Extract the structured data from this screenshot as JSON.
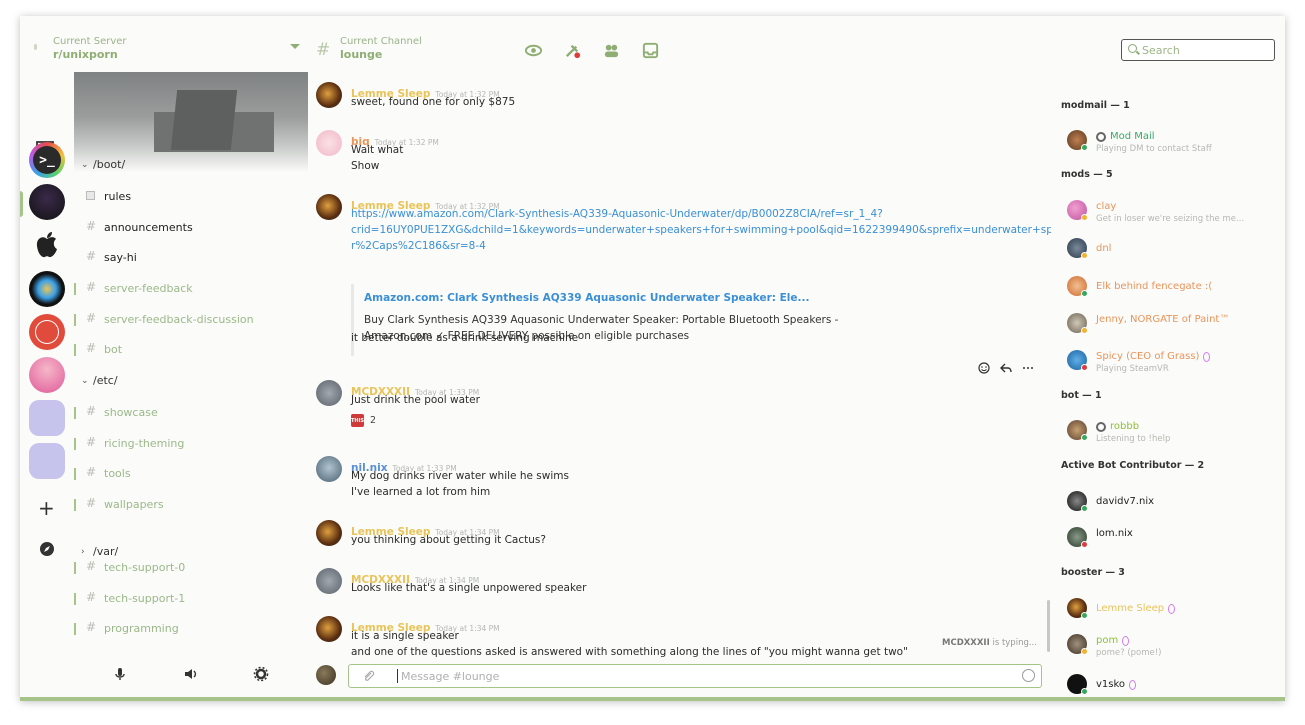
{
  "header": {
    "server_label": "Current Server",
    "server_name": "r/unixporn",
    "channel_label": "Current Channel",
    "channel_name": "lounge",
    "search_placeholder": "Search"
  },
  "channels": {
    "categories": [
      "/boot/",
      "/etc/",
      "/var/"
    ],
    "items": [
      {
        "name": "rules",
        "state": "read"
      },
      {
        "name": "announcements",
        "state": "read"
      },
      {
        "name": "say-hi",
        "state": "read"
      },
      {
        "name": "server-feedback",
        "state": "unread"
      },
      {
        "name": "server-feedback-discussion",
        "state": "unread"
      },
      {
        "name": "bot",
        "state": "unread"
      },
      {
        "name": "showcase",
        "state": "unread"
      },
      {
        "name": "ricing-theming",
        "state": "unread"
      },
      {
        "name": "tools",
        "state": "unread"
      },
      {
        "name": "wallpapers",
        "state": "unread"
      },
      {
        "name": "tech-support-0",
        "state": "unread"
      },
      {
        "name": "tech-support-1",
        "state": "unread"
      },
      {
        "name": "programming",
        "state": "unread"
      }
    ]
  },
  "messages": [
    {
      "author": "Lemme Sleep",
      "color": "#e8c45a",
      "time": "Today at 1:32 PM",
      "lines": [
        "sweet, found one for only $875"
      ]
    },
    {
      "author": "biq",
      "color": "#e8955a",
      "time": "Today at 1:32 PM",
      "lines": [
        "Wait what",
        "Show"
      ]
    },
    {
      "author": "Lemme Sleep",
      "color": "#e8c45a",
      "time": "Today at 1:32 PM",
      "link_lines": [
        "https://www.amazon.com/Clark-Synthesis-AQ339-Aquasonic-Underwater/dp/B0002Z8CIA/ref=sr_1_4?",
        "crid=16UY0PUE1ZXG&dchild=1&keywords=underwater+speakers+for+swimming+pool&qid=1622399490&sprefix=underwater+speake",
        "r%2Caps%2C186&sr=8-4"
      ],
      "embed": {
        "title": "Amazon.com: Clark Synthesis AQ339 Aquasonic Underwater Speaker: Ele...",
        "desc1": "Buy Clark Synthesis AQ339 Aquasonic Underwater Speaker: Portable Bluetooth Speakers -",
        "desc2": "Amazon.com ✓ FREE DELIVERY possible on eligible purchases"
      },
      "after": "it better double as a drink serving machine"
    },
    {
      "author": "MCDXXXII",
      "color": "#e8c45a",
      "time": "Today at 1:33 PM",
      "lines": [
        "Just drink the pool water"
      ],
      "reaction": {
        "emoji": "THIS",
        "count": "2"
      }
    },
    {
      "author": "nil.nix",
      "color": "#5a8fd6",
      "time": "Today at 1:33 PM",
      "lines": [
        "My dog drinks river water while he swims",
        "I've learned a lot from him"
      ]
    },
    {
      "author": "Lemme Sleep",
      "color": "#e8c45a",
      "time": "Today at 1:34 PM",
      "lines": [
        "you thinking about getting it Cactus?"
      ]
    },
    {
      "author": "MCDXXXII",
      "color": "#e8c45a",
      "time": "Today at 1:34 PM",
      "lines": [
        "Looks like that's a single unpowered speaker"
      ]
    },
    {
      "author": "Lemme Sleep",
      "color": "#e8c45a",
      "time": "Today at 1:34 PM",
      "lines": [
        "it is a single speaker",
        "and one of the questions asked is answered with something along the lines of \"you might wanna get two\""
      ]
    }
  ],
  "typing": {
    "user": "MCDXXXII",
    "text": "is typing..."
  },
  "composer": {
    "placeholder": "Message #lounge"
  },
  "members": {
    "groups": [
      {
        "title": "modmail — 1",
        "members": [
          {
            "name": "Mod Mail",
            "status": "Playing DM to contact Staff",
            "color": "#3aa86a",
            "dot": "#3aa55c"
          }
        ]
      },
      {
        "title": "mods — 5",
        "members": [
          {
            "name": "clay",
            "status": "Get in loser we're seizing the me...",
            "color": "#e8955a",
            "dot": "#f0b232"
          },
          {
            "name": "dnl",
            "status": "",
            "color": "#e8955a",
            "dot": "#f0b232"
          },
          {
            "name": "Elk behind fencegate :(",
            "status": "",
            "color": "#e8955a",
            "dot": "#3aa55c"
          },
          {
            "name": "Jenny, NORGATE of Paint™",
            "status": "",
            "color": "#e8955a",
            "dot": "#f0b232"
          },
          {
            "name": "Spicy (CEO of Grass)",
            "status": "Playing SteamVR",
            "color": "#e8955a",
            "dot": "#d83c3e"
          }
        ]
      },
      {
        "title": "bot — 1",
        "members": [
          {
            "name": "robbb",
            "status": "Listening to !help",
            "color": "#8fbf3a",
            "dot": "#3aa55c"
          }
        ]
      },
      {
        "title": "Active Bot Contributor — 2",
        "members": [
          {
            "name": "davidv7.nix",
            "status": "",
            "color": "#222",
            "dot": "#3aa55c"
          },
          {
            "name": "lom.nix",
            "status": "",
            "color": "#222",
            "dot": "#d83c3e"
          }
        ]
      },
      {
        "title": "booster — 3",
        "members": [
          {
            "name": "Lemme Sleep",
            "status": "",
            "color": "#e8c45a",
            "dot": "#3aa55c"
          },
          {
            "name": "pom",
            "status": "pome? (pome!)",
            "color": "#8fbf3a",
            "dot": "#f0b232"
          },
          {
            "name": "v1sko",
            "status": "",
            "color": "#222",
            "dot": "#3aa55c"
          }
        ]
      }
    ]
  },
  "colors": {
    "accent": "#a6c48a",
    "link": "#3a8fd6"
  }
}
